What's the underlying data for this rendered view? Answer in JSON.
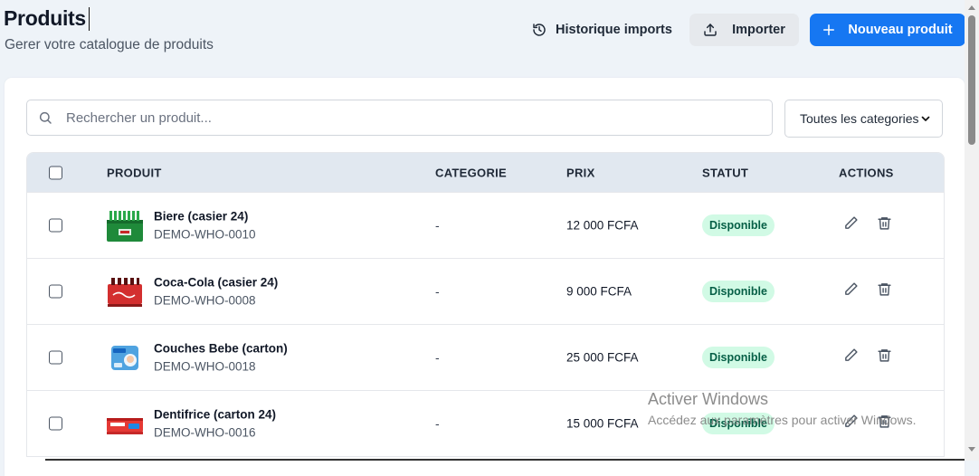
{
  "header": {
    "title": "Produits",
    "subtitle": "Gerer votre catalogue de produits",
    "history_label": "Historique imports",
    "import_label": "Importer",
    "new_label": "Nouveau produit"
  },
  "filters": {
    "search_placeholder": "Rechercher un produit...",
    "category_selected": "Toutes les categories"
  },
  "table": {
    "columns": [
      "PRODUIT",
      "CATEGORIE",
      "PRIX",
      "STATUT",
      "ACTIONS"
    ],
    "rows": [
      {
        "name": "Biere (casier 24)",
        "sku": "DEMO-WHO-0010",
        "category": "-",
        "price": "12 000 FCFA",
        "status": "Disponible",
        "thumb": "beer-crate-icon"
      },
      {
        "name": "Coca-Cola (casier 24)",
        "sku": "DEMO-WHO-0008",
        "category": "-",
        "price": "9 000 FCFA",
        "status": "Disponible",
        "thumb": "cola-crate-icon"
      },
      {
        "name": "Couches Bebe (carton)",
        "sku": "DEMO-WHO-0018",
        "category": "-",
        "price": "25 000 FCFA",
        "status": "Disponible",
        "thumb": "diapers-pack-icon"
      },
      {
        "name": "Dentifrice (carton 24)",
        "sku": "DEMO-WHO-0016",
        "category": "-",
        "price": "15 000 FCFA",
        "status": "Disponible",
        "thumb": "toothpaste-box-icon"
      }
    ]
  },
  "watermark": {
    "title": "Activer Windows",
    "subtitle": "Accédez aux paramètres pour activer Windows."
  },
  "colors": {
    "primary": "#1677f2",
    "badge_bg": "#d1fae5",
    "badge_text": "#065f46",
    "table_header_bg": "#e1e8f0"
  }
}
